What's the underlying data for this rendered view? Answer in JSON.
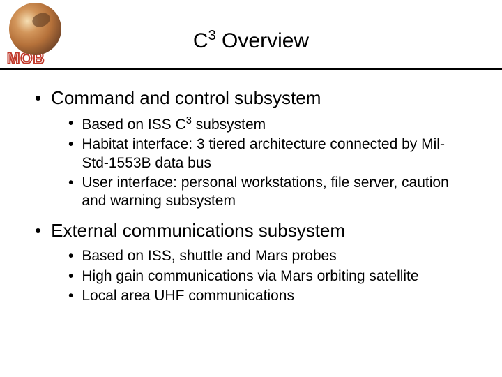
{
  "logo": {
    "label": "MOB"
  },
  "title": {
    "prefix": "C",
    "sup": "3",
    "suffix": " Overview"
  },
  "bullets": [
    {
      "heading": "Command and control subsystem",
      "sub": [
        {
          "prefix": "Based on ISS C",
          "sup": "3",
          "suffix": " subsystem"
        },
        {
          "text": "Habitat interface:  3 tiered architecture connected by Mil-Std-1553B data bus"
        },
        {
          "text": "User interface:  personal workstations, file server, caution and warning subsystem"
        }
      ]
    },
    {
      "heading": "External communications subsystem",
      "sub": [
        {
          "text": "Based on ISS, shuttle and Mars probes"
        },
        {
          "text": "High gain communications via Mars orbiting satellite"
        },
        {
          "text": "Local area UHF communications"
        }
      ]
    }
  ]
}
